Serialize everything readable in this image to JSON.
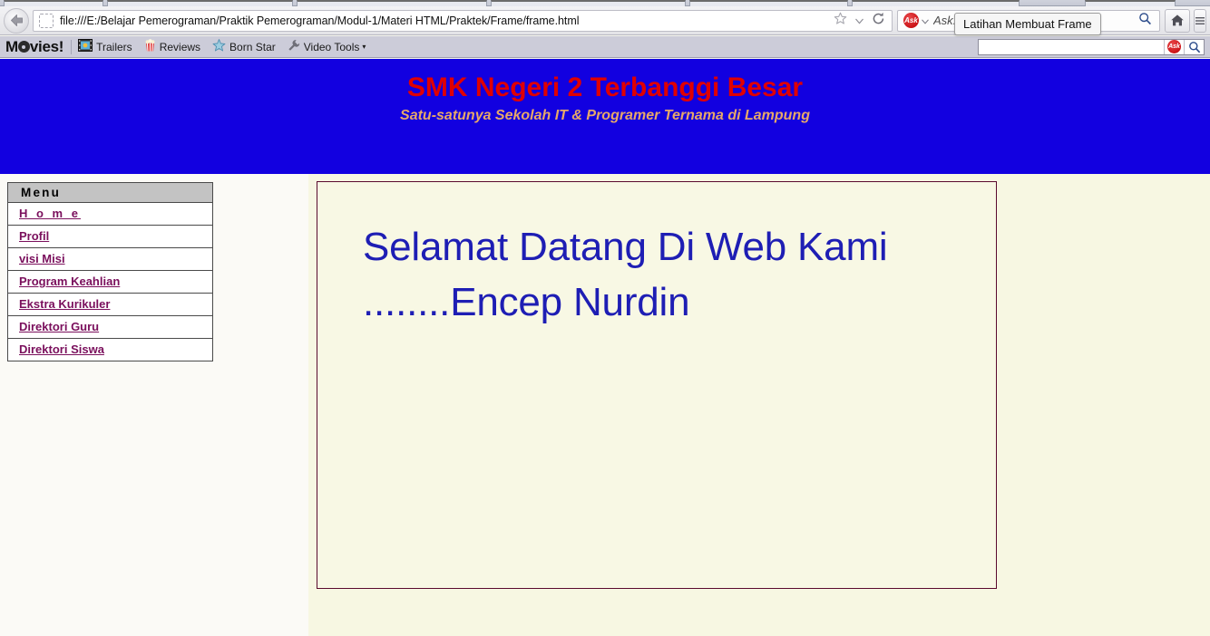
{
  "browser": {
    "back_icon": "back-arrow-icon",
    "favicon": "favicon-placeholder-icon",
    "url": "file:///E:/Belajar Pemerograman/Praktik Pemerograman/Modul-1/Materi HTML/Praktek/Frame/frame.html",
    "bookmark_icon": "star-icon",
    "bookmark_caret_icon": "chevron-down-icon",
    "reload_icon": "reload-icon",
    "search": {
      "provider": "Ask",
      "provider_badge": "Ask",
      "placeholder": "Ask.com",
      "value": "",
      "search_icon": "magnifier-icon"
    },
    "home_icon": "home-icon",
    "menu_icon": "app-menu-icon",
    "tooltip": "Latihan Membuat Frame"
  },
  "movies_toolbar": {
    "brand_prefix": "M",
    "brand_suffix": "vies!",
    "brand_reel_icon": "film-reel-icon",
    "items": [
      {
        "label": "Trailers",
        "icon": "film-strip-icon",
        "caret": false
      },
      {
        "label": "Reviews",
        "icon": "popcorn-icon",
        "caret": false
      },
      {
        "label": "Born Star",
        "icon": "star-icon",
        "caret": false
      },
      {
        "label": "Video Tools",
        "icon": "wrench-icon",
        "caret": true
      }
    ],
    "caret_glyph": "▾",
    "search": {
      "value": "",
      "placeholder": "",
      "ask_badge": "Ask",
      "search_icon": "magnifier-icon"
    }
  },
  "page": {
    "banner": {
      "title": "SMK Negeri 2 Terbanggi Besar",
      "subtitle": "Satu-satunya Sekolah IT & Programer Ternama di Lampung",
      "background_color": "#1200e0",
      "title_color": "#e00000",
      "subtitle_color": "#e6a86a"
    },
    "menu": {
      "header": "Menu",
      "items": [
        {
          "label": "H o m e",
          "spaced": true
        },
        {
          "label": "Profil",
          "spaced": false
        },
        {
          "label": "visi Misi",
          "spaced": false
        },
        {
          "label": "Program Keahlian",
          "spaced": false
        },
        {
          "label": "Ekstra Kurikuler",
          "spaced": false
        },
        {
          "label": "Direktori Guru",
          "spaced": false
        },
        {
          "label": "Direktori Siswa",
          "spaced": false
        }
      ],
      "link_color": "#7a0f5c",
      "header_background": "#c3c3c3"
    },
    "content": {
      "heading": "Selamat Datang Di Web Kami ........Encep Nurdin",
      "heading_color": "#1e1eb4",
      "box_border_color": "#5a0a2e",
      "box_background": "#f8f8e4"
    }
  }
}
